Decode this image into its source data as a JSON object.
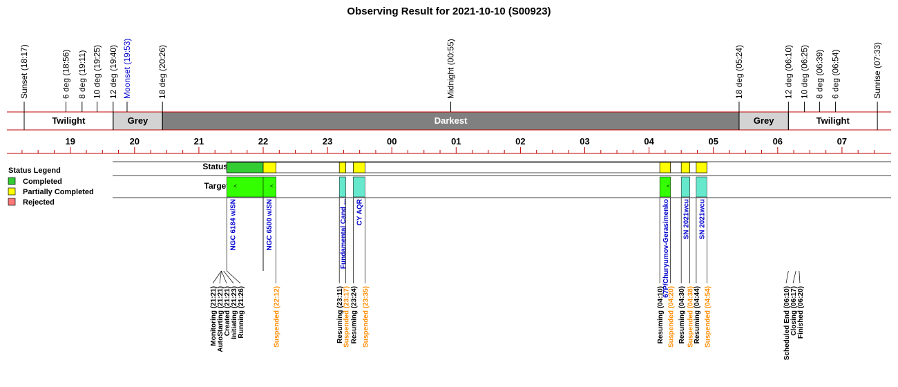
{
  "chart_data": {
    "type": "timeline",
    "title": "Observing Result for 2021-10-10 (S00923)",
    "x_range_hours": [
      18.0,
      31.5
    ],
    "hour_ticks": [
      "19",
      "20",
      "21",
      "22",
      "23",
      "00",
      "01",
      "02",
      "03",
      "04",
      "05",
      "06",
      "07"
    ],
    "sky_events": [
      {
        "label": "Sunset (18:17)",
        "time": "18:17",
        "moon": false
      },
      {
        "label": "6 deg (18:56)",
        "time": "18:56",
        "moon": false
      },
      {
        "label": "8 deg (19:11)",
        "time": "19:11",
        "moon": false
      },
      {
        "label": "10 deg (19:25)",
        "time": "19:25",
        "moon": false
      },
      {
        "label": "12 deg (19:40)",
        "time": "19:40",
        "moon": false
      },
      {
        "label": "Moonset (19:53)",
        "time": "19:53",
        "moon": true
      },
      {
        "label": "18 deg (20:26)",
        "time": "20:26",
        "moon": false
      },
      {
        "label": "Midnight (00:55)",
        "time": "00:55",
        "moon": false
      },
      {
        "label": "18 deg (05:24)",
        "time": "05:24",
        "moon": false
      },
      {
        "label": "12 deg (06:10)",
        "time": "06:10",
        "moon": false
      },
      {
        "label": "10 deg (06:25)",
        "time": "06:25",
        "moon": false
      },
      {
        "label": "8 deg (06:39)",
        "time": "06:39",
        "moon": false
      },
      {
        "label": "6 deg (06:54)",
        "time": "06:54",
        "moon": false
      },
      {
        "label": "Sunrise (07:33)",
        "time": "07:33",
        "moon": false
      }
    ],
    "bands": [
      {
        "label": "Twilight",
        "start": "18:17",
        "end": "19:40",
        "fill": "#ffffff",
        "text": "#000000"
      },
      {
        "label": "Grey",
        "start": "19:40",
        "end": "20:26",
        "fill": "#d3d3d3",
        "text": "#000000"
      },
      {
        "label": "Darkest",
        "start": "20:26",
        "end": "05:24",
        "fill": "#808080",
        "text": "#ffffff"
      },
      {
        "label": "Grey",
        "start": "05:24",
        "end": "06:10",
        "fill": "#d3d3d3",
        "text": "#000000"
      },
      {
        "label": "Twilight",
        "start": "06:10",
        "end": "07:33",
        "fill": "#ffffff",
        "text": "#000000"
      }
    ],
    "rows": {
      "status": "Status",
      "targets": "Targets"
    },
    "status_blocks": [
      {
        "start": "21:26",
        "end": "22:00",
        "status": "completed"
      },
      {
        "start": "22:00",
        "end": "22:12",
        "status": "partial"
      },
      {
        "start": "23:11",
        "end": "23:17",
        "status": "partial"
      },
      {
        "start": "23:24",
        "end": "23:35",
        "status": "partial"
      },
      {
        "start": "04:10",
        "end": "04:20",
        "status": "partial"
      },
      {
        "start": "04:30",
        "end": "04:38",
        "status": "partial"
      },
      {
        "start": "04:44",
        "end": "04:54",
        "status": "partial"
      }
    ],
    "target_blocks": [
      {
        "start": "21:26",
        "end": "22:00",
        "label": "NGC 6184 w/SN",
        "color": "#33ff00",
        "marker": "<"
      },
      {
        "start": "22:00",
        "end": "22:12",
        "label": "NGC 6500 w/SN",
        "color": "#33ff00",
        "marker": "<"
      },
      {
        "start": "23:11",
        "end": "23:17",
        "label": "Fundamental Cand ...",
        "color": "#66e8cc",
        "marker": ""
      },
      {
        "start": "23:24",
        "end": "23:35",
        "label": "CY AQR",
        "color": "#66e8cc",
        "marker": ""
      },
      {
        "start": "04:10",
        "end": "04:20",
        "label": "67P/Churyumov-Gerasimenko",
        "color": "#33ff00",
        "marker": "<"
      },
      {
        "start": "04:30",
        "end": "04:38",
        "label": "SN 2021wcu",
        "color": "#66e8cc",
        "marker": ""
      },
      {
        "start": "04:44",
        "end": "04:54",
        "label": "SN 2021wcu",
        "color": "#66e8cc",
        "marker": ""
      }
    ],
    "events": [
      {
        "label": "Monitoring (21:21)",
        "time": "21:21",
        "kind": "normal"
      },
      {
        "label": "AutoStarting (21:21)",
        "time": "21:21",
        "kind": "normal"
      },
      {
        "label": "Created (21:21)",
        "time": "21:21",
        "kind": "normal"
      },
      {
        "label": "Initiating (21:23)",
        "time": "21:23",
        "kind": "normal"
      },
      {
        "label": "Running (21:26)",
        "time": "21:26",
        "kind": "normal"
      },
      {
        "label": "Suspended (22:12)",
        "time": "22:12",
        "kind": "suspended"
      },
      {
        "label": "Resuming (23:11)",
        "time": "23:11",
        "kind": "normal"
      },
      {
        "label": "Suspended (23:17)",
        "time": "23:17",
        "kind": "suspended"
      },
      {
        "label": "Resuming (23:24)",
        "time": "23:24",
        "kind": "normal"
      },
      {
        "label": "Suspended (23:35)",
        "time": "23:35",
        "kind": "suspended"
      },
      {
        "label": "Resuming (04:10)",
        "time": "04:10",
        "kind": "normal"
      },
      {
        "label": "Suspended (04:20)",
        "time": "04:20",
        "kind": "suspended"
      },
      {
        "label": "Resuming (04:30)",
        "time": "04:30",
        "kind": "normal"
      },
      {
        "label": "Suspended (04:38)",
        "time": "04:38",
        "kind": "suspended"
      },
      {
        "label": "Resuming (04:44)",
        "time": "04:44",
        "kind": "normal"
      },
      {
        "label": "Suspended (04:54)",
        "time": "04:54",
        "kind": "suspended"
      },
      {
        "label": "Scheduled End (06:10)",
        "time": "06:10",
        "kind": "normal"
      },
      {
        "label": "Closing (06:17)",
        "time": "06:17",
        "kind": "normal"
      },
      {
        "label": "Finished (06:20)",
        "time": "06:20",
        "kind": "normal"
      }
    ],
    "legend": {
      "title": "Status Legend",
      "items": [
        {
          "label": "Completed",
          "color": "#33cc33"
        },
        {
          "label": "Partially Completed",
          "color": "#ffff00"
        },
        {
          "label": "Rejected",
          "color": "#ff7777"
        }
      ]
    },
    "colors": {
      "completed": "#33cc33",
      "partial": "#ffff00",
      "rejected": "#ff7777",
      "axis_line": "#c00000",
      "moon_text": "#0000cc",
      "suspended_text": "#ff8c00"
    }
  }
}
